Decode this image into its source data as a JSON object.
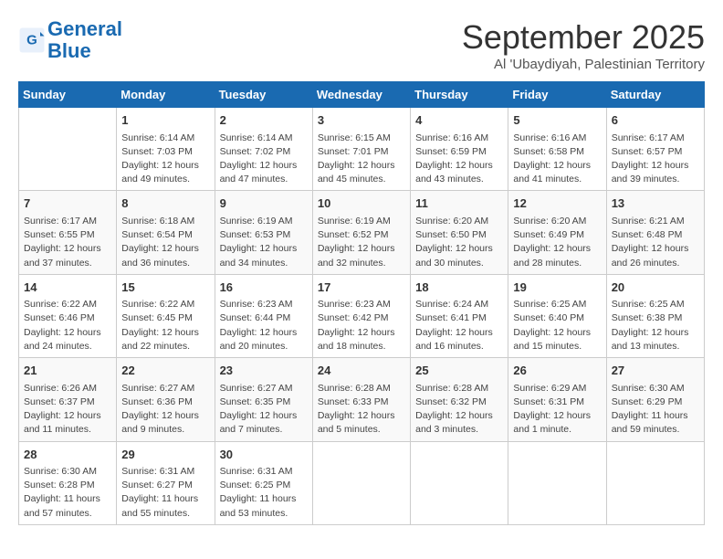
{
  "logo": {
    "line1": "General",
    "line2": "Blue"
  },
  "title": "September 2025",
  "location": "Al 'Ubaydiyah, Palestinian Territory",
  "days_of_week": [
    "Sunday",
    "Monday",
    "Tuesday",
    "Wednesday",
    "Thursday",
    "Friday",
    "Saturday"
  ],
  "weeks": [
    [
      null,
      {
        "day": "1",
        "sunrise": "Sunrise: 6:14 AM",
        "sunset": "Sunset: 7:03 PM",
        "daylight": "Daylight: 12 hours and 49 minutes."
      },
      {
        "day": "2",
        "sunrise": "Sunrise: 6:14 AM",
        "sunset": "Sunset: 7:02 PM",
        "daylight": "Daylight: 12 hours and 47 minutes."
      },
      {
        "day": "3",
        "sunrise": "Sunrise: 6:15 AM",
        "sunset": "Sunset: 7:01 PM",
        "daylight": "Daylight: 12 hours and 45 minutes."
      },
      {
        "day": "4",
        "sunrise": "Sunrise: 6:16 AM",
        "sunset": "Sunset: 6:59 PM",
        "daylight": "Daylight: 12 hours and 43 minutes."
      },
      {
        "day": "5",
        "sunrise": "Sunrise: 6:16 AM",
        "sunset": "Sunset: 6:58 PM",
        "daylight": "Daylight: 12 hours and 41 minutes."
      },
      {
        "day": "6",
        "sunrise": "Sunrise: 6:17 AM",
        "sunset": "Sunset: 6:57 PM",
        "daylight": "Daylight: 12 hours and 39 minutes."
      }
    ],
    [
      {
        "day": "7",
        "sunrise": "Sunrise: 6:17 AM",
        "sunset": "Sunset: 6:55 PM",
        "daylight": "Daylight: 12 hours and 37 minutes."
      },
      {
        "day": "8",
        "sunrise": "Sunrise: 6:18 AM",
        "sunset": "Sunset: 6:54 PM",
        "daylight": "Daylight: 12 hours and 36 minutes."
      },
      {
        "day": "9",
        "sunrise": "Sunrise: 6:19 AM",
        "sunset": "Sunset: 6:53 PM",
        "daylight": "Daylight: 12 hours and 34 minutes."
      },
      {
        "day": "10",
        "sunrise": "Sunrise: 6:19 AM",
        "sunset": "Sunset: 6:52 PM",
        "daylight": "Daylight: 12 hours and 32 minutes."
      },
      {
        "day": "11",
        "sunrise": "Sunrise: 6:20 AM",
        "sunset": "Sunset: 6:50 PM",
        "daylight": "Daylight: 12 hours and 30 minutes."
      },
      {
        "day": "12",
        "sunrise": "Sunrise: 6:20 AM",
        "sunset": "Sunset: 6:49 PM",
        "daylight": "Daylight: 12 hours and 28 minutes."
      },
      {
        "day": "13",
        "sunrise": "Sunrise: 6:21 AM",
        "sunset": "Sunset: 6:48 PM",
        "daylight": "Daylight: 12 hours and 26 minutes."
      }
    ],
    [
      {
        "day": "14",
        "sunrise": "Sunrise: 6:22 AM",
        "sunset": "Sunset: 6:46 PM",
        "daylight": "Daylight: 12 hours and 24 minutes."
      },
      {
        "day": "15",
        "sunrise": "Sunrise: 6:22 AM",
        "sunset": "Sunset: 6:45 PM",
        "daylight": "Daylight: 12 hours and 22 minutes."
      },
      {
        "day": "16",
        "sunrise": "Sunrise: 6:23 AM",
        "sunset": "Sunset: 6:44 PM",
        "daylight": "Daylight: 12 hours and 20 minutes."
      },
      {
        "day": "17",
        "sunrise": "Sunrise: 6:23 AM",
        "sunset": "Sunset: 6:42 PM",
        "daylight": "Daylight: 12 hours and 18 minutes."
      },
      {
        "day": "18",
        "sunrise": "Sunrise: 6:24 AM",
        "sunset": "Sunset: 6:41 PM",
        "daylight": "Daylight: 12 hours and 16 minutes."
      },
      {
        "day": "19",
        "sunrise": "Sunrise: 6:25 AM",
        "sunset": "Sunset: 6:40 PM",
        "daylight": "Daylight: 12 hours and 15 minutes."
      },
      {
        "day": "20",
        "sunrise": "Sunrise: 6:25 AM",
        "sunset": "Sunset: 6:38 PM",
        "daylight": "Daylight: 12 hours and 13 minutes."
      }
    ],
    [
      {
        "day": "21",
        "sunrise": "Sunrise: 6:26 AM",
        "sunset": "Sunset: 6:37 PM",
        "daylight": "Daylight: 12 hours and 11 minutes."
      },
      {
        "day": "22",
        "sunrise": "Sunrise: 6:27 AM",
        "sunset": "Sunset: 6:36 PM",
        "daylight": "Daylight: 12 hours and 9 minutes."
      },
      {
        "day": "23",
        "sunrise": "Sunrise: 6:27 AM",
        "sunset": "Sunset: 6:35 PM",
        "daylight": "Daylight: 12 hours and 7 minutes."
      },
      {
        "day": "24",
        "sunrise": "Sunrise: 6:28 AM",
        "sunset": "Sunset: 6:33 PM",
        "daylight": "Daylight: 12 hours and 5 minutes."
      },
      {
        "day": "25",
        "sunrise": "Sunrise: 6:28 AM",
        "sunset": "Sunset: 6:32 PM",
        "daylight": "Daylight: 12 hours and 3 minutes."
      },
      {
        "day": "26",
        "sunrise": "Sunrise: 6:29 AM",
        "sunset": "Sunset: 6:31 PM",
        "daylight": "Daylight: 12 hours and 1 minute."
      },
      {
        "day": "27",
        "sunrise": "Sunrise: 6:30 AM",
        "sunset": "Sunset: 6:29 PM",
        "daylight": "Daylight: 11 hours and 59 minutes."
      }
    ],
    [
      {
        "day": "28",
        "sunrise": "Sunrise: 6:30 AM",
        "sunset": "Sunset: 6:28 PM",
        "daylight": "Daylight: 11 hours and 57 minutes."
      },
      {
        "day": "29",
        "sunrise": "Sunrise: 6:31 AM",
        "sunset": "Sunset: 6:27 PM",
        "daylight": "Daylight: 11 hours and 55 minutes."
      },
      {
        "day": "30",
        "sunrise": "Sunrise: 6:31 AM",
        "sunset": "Sunset: 6:25 PM",
        "daylight": "Daylight: 11 hours and 53 minutes."
      },
      null,
      null,
      null,
      null
    ]
  ]
}
